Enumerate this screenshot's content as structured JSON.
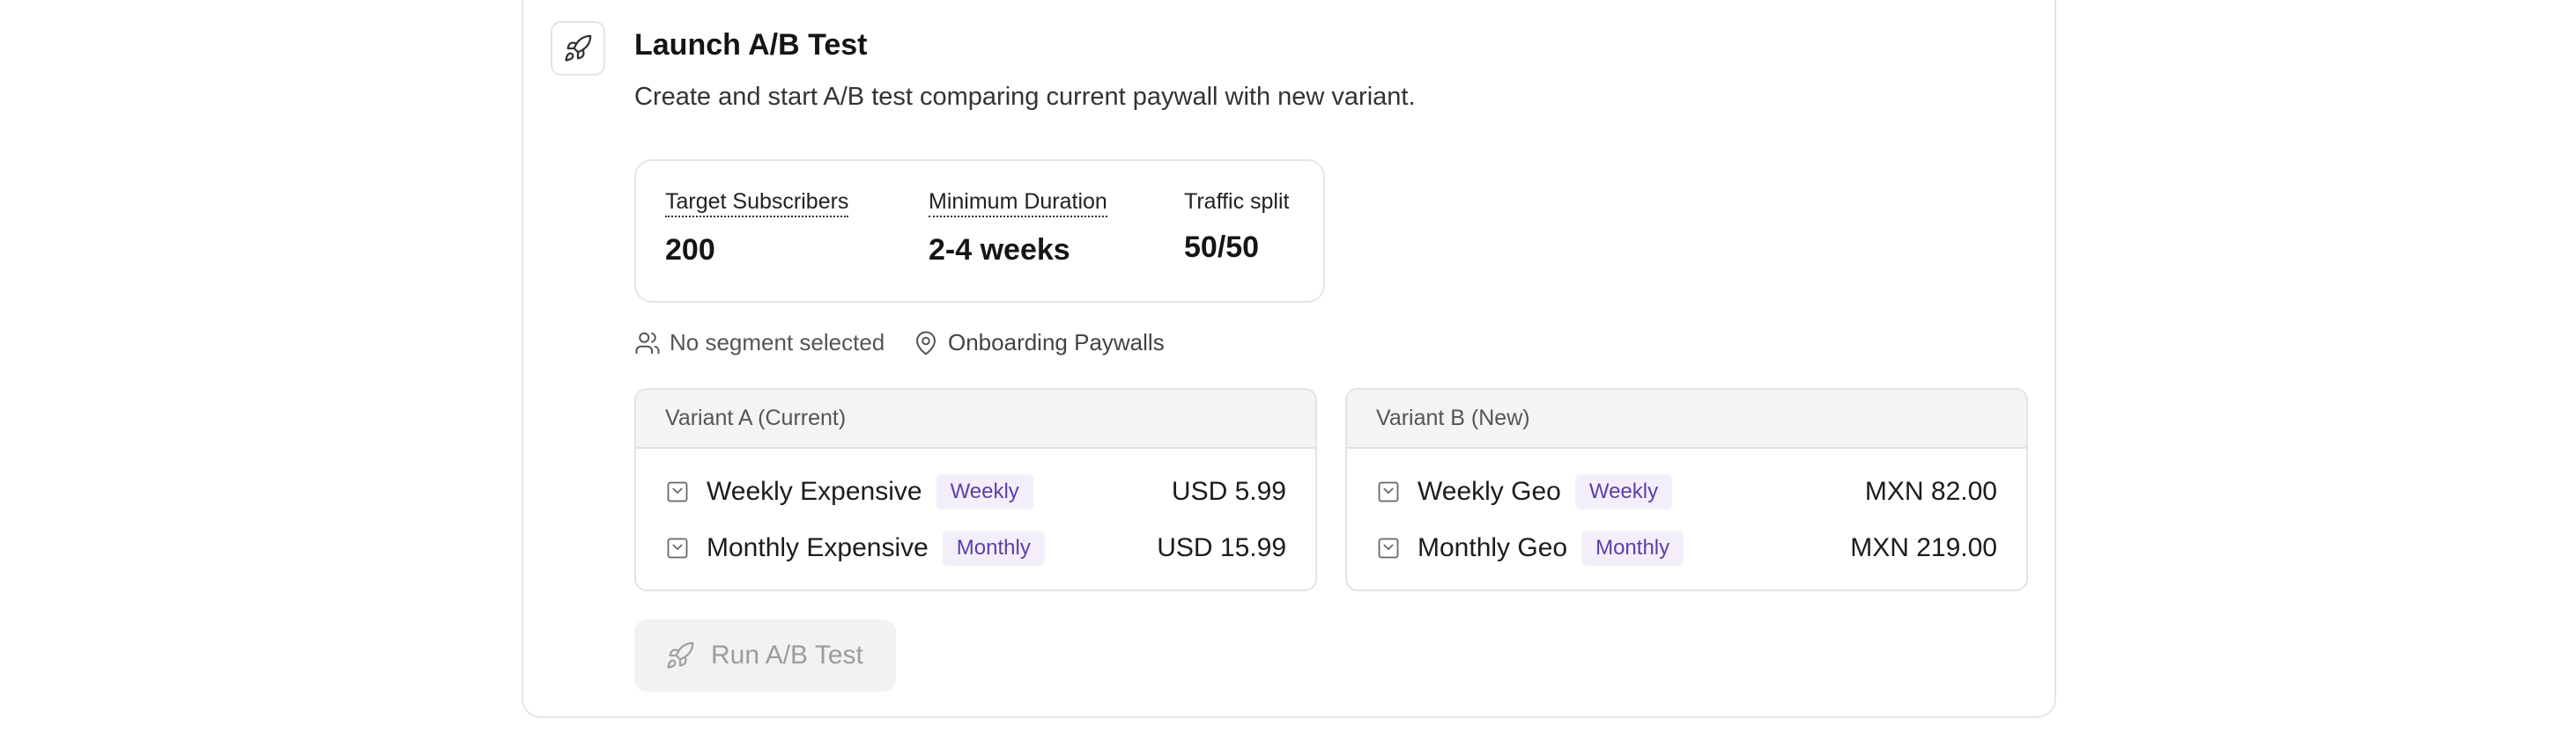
{
  "header": {
    "icon": "rocket-icon",
    "title": "Launch A/B Test",
    "description": "Create and start A/B test comparing current paywall with new variant."
  },
  "stats": {
    "target_subscribers": {
      "label": "Target Subscribers",
      "value": "200"
    },
    "minimum_duration": {
      "label": "Minimum Duration",
      "value": "2-4 weeks"
    },
    "traffic_split": {
      "label": "Traffic split",
      "value": "50/50"
    }
  },
  "meta": {
    "segment": {
      "icon": "users-icon",
      "text": "No segment selected"
    },
    "placement": {
      "icon": "map-pin-icon",
      "text": "Onboarding Paywalls"
    }
  },
  "variants": [
    {
      "title": "Variant A (Current)",
      "products": [
        {
          "name": "Weekly Expensive",
          "tag": "Weekly",
          "price": "USD 5.99"
        },
        {
          "name": "Monthly Expensive",
          "tag": "Monthly",
          "price": "USD 15.99"
        }
      ]
    },
    {
      "title": "Variant B (New)",
      "products": [
        {
          "name": "Weekly Geo",
          "tag": "Weekly",
          "price": "MXN 82.00"
        },
        {
          "name": "Monthly Geo",
          "tag": "Monthly",
          "price": "MXN 219.00"
        }
      ]
    }
  ],
  "actions": {
    "run_label": "Run A/B Test",
    "run_icon": "rocket-icon",
    "run_disabled": true
  },
  "colors": {
    "tag_bg": "#f2effa",
    "tag_text": "#5b3fa6",
    "button_disabled_bg": "#f2f2f2",
    "button_disabled_text": "#9c9c9c"
  }
}
